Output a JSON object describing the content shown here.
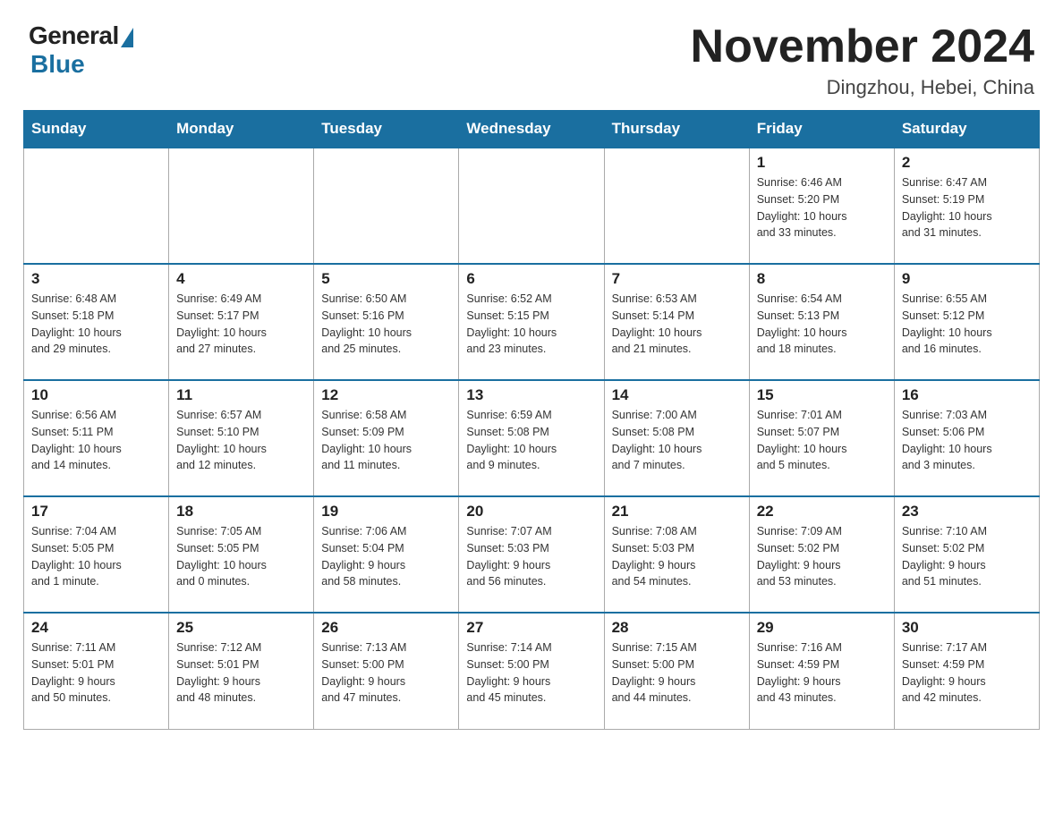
{
  "header": {
    "logo": {
      "general": "General",
      "blue": "Blue"
    },
    "title": "November 2024",
    "location": "Dingzhou, Hebei, China"
  },
  "weekdays": [
    "Sunday",
    "Monday",
    "Tuesday",
    "Wednesday",
    "Thursday",
    "Friday",
    "Saturday"
  ],
  "weeks": [
    {
      "days": [
        {
          "number": "",
          "info": ""
        },
        {
          "number": "",
          "info": ""
        },
        {
          "number": "",
          "info": ""
        },
        {
          "number": "",
          "info": ""
        },
        {
          "number": "",
          "info": ""
        },
        {
          "number": "1",
          "info": "Sunrise: 6:46 AM\nSunset: 5:20 PM\nDaylight: 10 hours\nand 33 minutes."
        },
        {
          "number": "2",
          "info": "Sunrise: 6:47 AM\nSunset: 5:19 PM\nDaylight: 10 hours\nand 31 minutes."
        }
      ]
    },
    {
      "days": [
        {
          "number": "3",
          "info": "Sunrise: 6:48 AM\nSunset: 5:18 PM\nDaylight: 10 hours\nand 29 minutes."
        },
        {
          "number": "4",
          "info": "Sunrise: 6:49 AM\nSunset: 5:17 PM\nDaylight: 10 hours\nand 27 minutes."
        },
        {
          "number": "5",
          "info": "Sunrise: 6:50 AM\nSunset: 5:16 PM\nDaylight: 10 hours\nand 25 minutes."
        },
        {
          "number": "6",
          "info": "Sunrise: 6:52 AM\nSunset: 5:15 PM\nDaylight: 10 hours\nand 23 minutes."
        },
        {
          "number": "7",
          "info": "Sunrise: 6:53 AM\nSunset: 5:14 PM\nDaylight: 10 hours\nand 21 minutes."
        },
        {
          "number": "8",
          "info": "Sunrise: 6:54 AM\nSunset: 5:13 PM\nDaylight: 10 hours\nand 18 minutes."
        },
        {
          "number": "9",
          "info": "Sunrise: 6:55 AM\nSunset: 5:12 PM\nDaylight: 10 hours\nand 16 minutes."
        }
      ]
    },
    {
      "days": [
        {
          "number": "10",
          "info": "Sunrise: 6:56 AM\nSunset: 5:11 PM\nDaylight: 10 hours\nand 14 minutes."
        },
        {
          "number": "11",
          "info": "Sunrise: 6:57 AM\nSunset: 5:10 PM\nDaylight: 10 hours\nand 12 minutes."
        },
        {
          "number": "12",
          "info": "Sunrise: 6:58 AM\nSunset: 5:09 PM\nDaylight: 10 hours\nand 11 minutes."
        },
        {
          "number": "13",
          "info": "Sunrise: 6:59 AM\nSunset: 5:08 PM\nDaylight: 10 hours\nand 9 minutes."
        },
        {
          "number": "14",
          "info": "Sunrise: 7:00 AM\nSunset: 5:08 PM\nDaylight: 10 hours\nand 7 minutes."
        },
        {
          "number": "15",
          "info": "Sunrise: 7:01 AM\nSunset: 5:07 PM\nDaylight: 10 hours\nand 5 minutes."
        },
        {
          "number": "16",
          "info": "Sunrise: 7:03 AM\nSunset: 5:06 PM\nDaylight: 10 hours\nand 3 minutes."
        }
      ]
    },
    {
      "days": [
        {
          "number": "17",
          "info": "Sunrise: 7:04 AM\nSunset: 5:05 PM\nDaylight: 10 hours\nand 1 minute."
        },
        {
          "number": "18",
          "info": "Sunrise: 7:05 AM\nSunset: 5:05 PM\nDaylight: 10 hours\nand 0 minutes."
        },
        {
          "number": "19",
          "info": "Sunrise: 7:06 AM\nSunset: 5:04 PM\nDaylight: 9 hours\nand 58 minutes."
        },
        {
          "number": "20",
          "info": "Sunrise: 7:07 AM\nSunset: 5:03 PM\nDaylight: 9 hours\nand 56 minutes."
        },
        {
          "number": "21",
          "info": "Sunrise: 7:08 AM\nSunset: 5:03 PM\nDaylight: 9 hours\nand 54 minutes."
        },
        {
          "number": "22",
          "info": "Sunrise: 7:09 AM\nSunset: 5:02 PM\nDaylight: 9 hours\nand 53 minutes."
        },
        {
          "number": "23",
          "info": "Sunrise: 7:10 AM\nSunset: 5:02 PM\nDaylight: 9 hours\nand 51 minutes."
        }
      ]
    },
    {
      "days": [
        {
          "number": "24",
          "info": "Sunrise: 7:11 AM\nSunset: 5:01 PM\nDaylight: 9 hours\nand 50 minutes."
        },
        {
          "number": "25",
          "info": "Sunrise: 7:12 AM\nSunset: 5:01 PM\nDaylight: 9 hours\nand 48 minutes."
        },
        {
          "number": "26",
          "info": "Sunrise: 7:13 AM\nSunset: 5:00 PM\nDaylight: 9 hours\nand 47 minutes."
        },
        {
          "number": "27",
          "info": "Sunrise: 7:14 AM\nSunset: 5:00 PM\nDaylight: 9 hours\nand 45 minutes."
        },
        {
          "number": "28",
          "info": "Sunrise: 7:15 AM\nSunset: 5:00 PM\nDaylight: 9 hours\nand 44 minutes."
        },
        {
          "number": "29",
          "info": "Sunrise: 7:16 AM\nSunset: 4:59 PM\nDaylight: 9 hours\nand 43 minutes."
        },
        {
          "number": "30",
          "info": "Sunrise: 7:17 AM\nSunset: 4:59 PM\nDaylight: 9 hours\nand 42 minutes."
        }
      ]
    }
  ]
}
